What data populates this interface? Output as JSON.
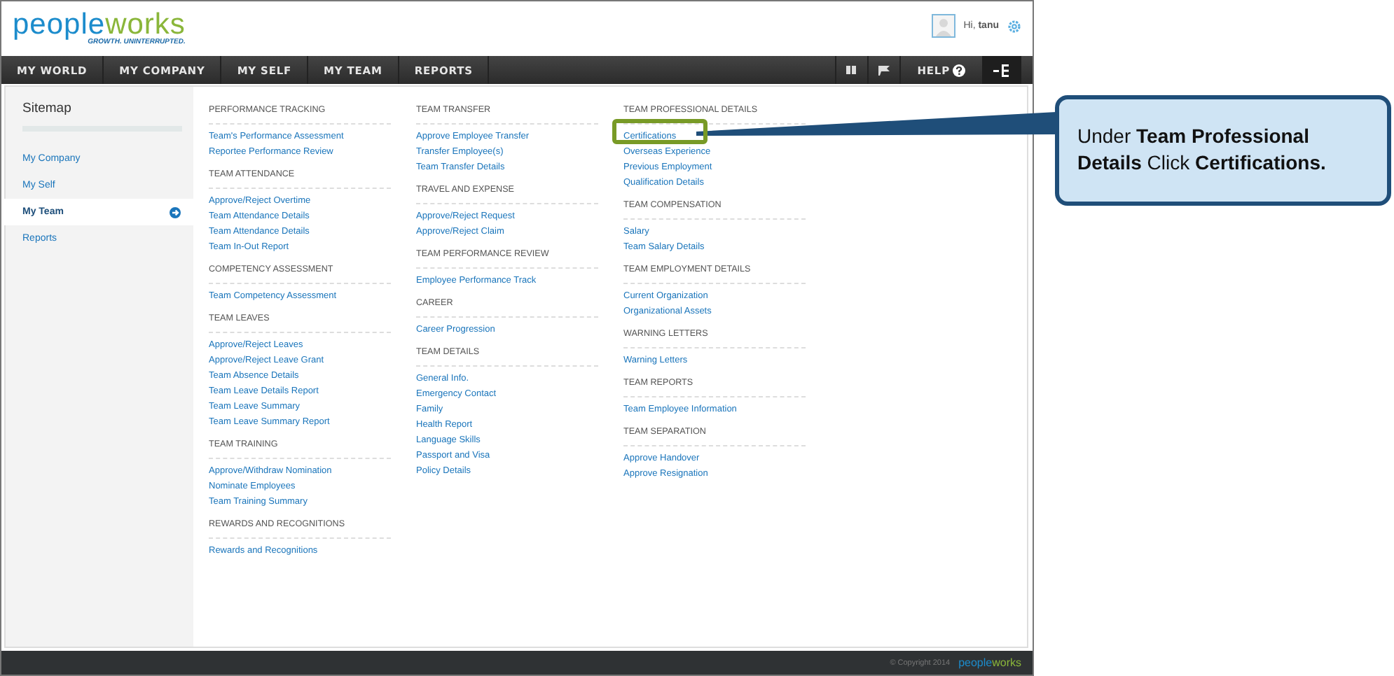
{
  "header": {
    "logo": {
      "left": "people",
      "right": "works",
      "tagline": "GROWTH. UNINTERRUPTED."
    },
    "greeting": "Hi, **tanu**"
  },
  "nav": {
    "items": [
      {
        "label": "MY WORLD",
        "selected": false
      },
      {
        "label": "MY COMPANY",
        "selected": false
      },
      {
        "label": "MY SELF",
        "selected": false
      },
      {
        "label": "MY TEAM",
        "selected": false
      },
      {
        "label": "REPORTS",
        "selected": false
      }
    ],
    "help": "HELP"
  },
  "sidebar": {
    "title": "Sitemap",
    "items": [
      {
        "label": "My Company",
        "selected": false
      },
      {
        "label": "My Self",
        "selected": false
      },
      {
        "label": "My Team",
        "selected": true
      },
      {
        "label": "Reports",
        "selected": false
      }
    ]
  },
  "columns": [
    [
      {
        "heading": "PERFORMANCE TRACKING",
        "links": [
          "Team's Performance Assessment",
          "Reportee Performance Review"
        ]
      },
      {
        "heading": "TEAM ATTENDANCE",
        "links": [
          "Approve/Reject Overtime",
          "Team Attendance Details",
          "Team Attendance Details",
          "Team In-Out Report"
        ]
      },
      {
        "heading": "COMPETENCY ASSESSMENT",
        "links": [
          "Team Competency Assessment"
        ]
      },
      {
        "heading": "TEAM LEAVES",
        "links": [
          "Approve/Reject Leaves",
          "Approve/Reject Leave Grant",
          "Team Absence Details",
          "Team Leave Details Report",
          "Team Leave Summary",
          "Team Leave Summary Report"
        ]
      },
      {
        "heading": "TEAM TRAINING",
        "links": [
          "Approve/Withdraw Nomination",
          "Nominate Employees",
          "Team Training Summary"
        ]
      },
      {
        "heading": "REWARDS AND RECOGNITIONS",
        "links": [
          "Rewards and Recognitions"
        ]
      }
    ],
    [
      {
        "heading": "TEAM TRANSFER",
        "links": [
          "Approve Employee Transfer",
          "Transfer Employee(s)",
          "Team Transfer Details"
        ]
      },
      {
        "heading": "TRAVEL AND EXPENSE",
        "links": [
          "Approve/Reject Request",
          "Approve/Reject Claim"
        ]
      },
      {
        "heading": "TEAM PERFORMANCE REVIEW",
        "links": [
          "Employee Performance Track"
        ]
      },
      {
        "heading": "CAREER",
        "links": [
          "Career Progression"
        ]
      },
      {
        "heading": "TEAM DETAILS",
        "links": [
          "General Info.",
          "Emergency Contact",
          "Family",
          "Health Report",
          "Language Skills",
          "Passport and Visa",
          "Policy Details"
        ]
      }
    ],
    [
      {
        "heading": "TEAM PROFESSIONAL DETAILS",
        "links": [
          "Certifications",
          "Overseas Experience",
          "Previous Employment",
          "Qualification Details"
        ]
      },
      {
        "heading": "TEAM COMPENSATION",
        "links": [
          "Salary",
          "Team Salary Details"
        ]
      },
      {
        "heading": "TEAM EMPLOYMENT DETAILS",
        "links": [
          "Current Organization",
          "Organizational Assets"
        ]
      },
      {
        "heading": "WARNING LETTERS",
        "links": [
          "Warning Letters"
        ]
      },
      {
        "heading": "TEAM REPORTS",
        "links": [
          "Team Employee Information"
        ]
      },
      {
        "heading": "TEAM SEPARATION",
        "links": [
          "Approve Handover",
          "Approve Resignation"
        ]
      }
    ]
  ],
  "footer": {
    "copyright": "© Copyright 2014",
    "logo_left": "people",
    "logo_right": "works"
  },
  "callout": {
    "text": "Under **Team Professional Details** Click **Certifications.**"
  }
}
